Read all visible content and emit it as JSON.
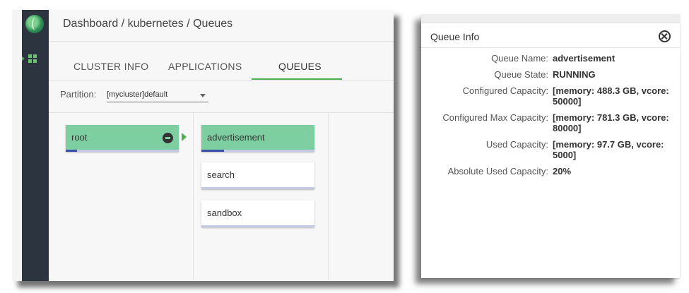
{
  "breadcrumb": "Dashboard / kubernetes / Queues",
  "tabs": [
    {
      "label": "CLUSTER INFO",
      "active": false
    },
    {
      "label": "APPLICATIONS",
      "active": false
    },
    {
      "label": "QUEUES",
      "active": true
    }
  ],
  "partition": {
    "label": "Partition:",
    "value": "[mycluster]default"
  },
  "queues": {
    "root": {
      "label": "root",
      "usage": 0.1
    },
    "children": [
      {
        "label": "advertisement",
        "usage": 0.2,
        "active": true
      },
      {
        "label": "search",
        "usage": 0,
        "active": false
      },
      {
        "label": "sandbox",
        "usage": 0,
        "active": false
      }
    ]
  },
  "queue_info": {
    "title": "Queue Info",
    "rows": [
      {
        "label": "Queue Name:",
        "value": "advertisement"
      },
      {
        "label": "Queue State:",
        "value": "RUNNING"
      },
      {
        "label": "Configured Capacity:",
        "value": "[memory: 488.3 GB, vcore: 50000]"
      },
      {
        "label": "Configured Max Capacity:",
        "value": "[memory: 781.3 GB, vcore: 80000]"
      },
      {
        "label": "Used Capacity:",
        "value": "[memory: 97.7 GB, vcore: 5000]"
      },
      {
        "label": "Absolute Used Capacity:",
        "value": "20%"
      }
    ]
  },
  "colors": {
    "accent": "#4caf50",
    "queue_active": "#7dcfa1",
    "usage_fill": "#3b4fa8",
    "sidebar": "#2c3440"
  }
}
